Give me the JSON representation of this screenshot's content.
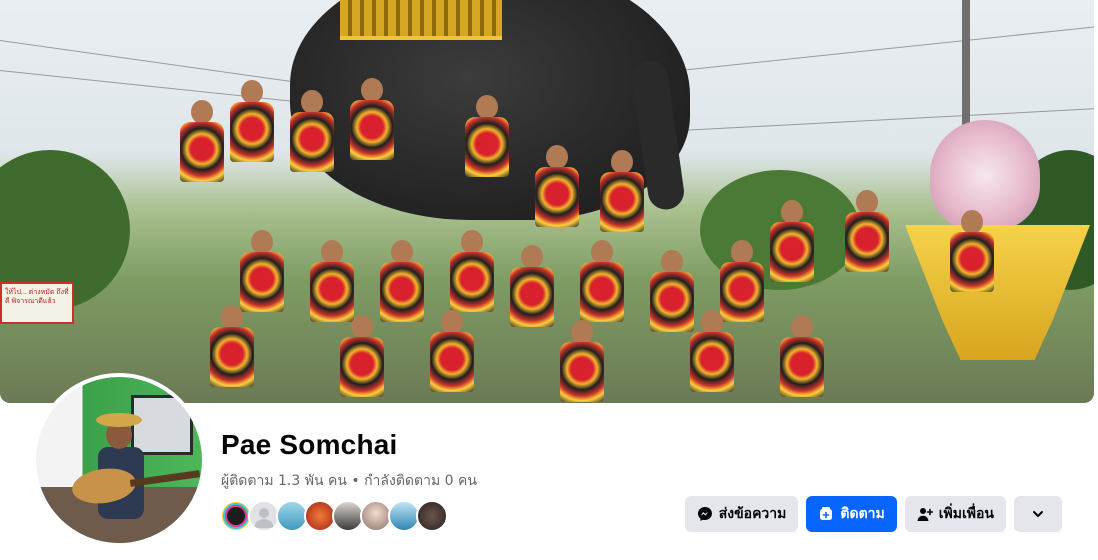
{
  "colors": {
    "primary_button": "#0866ff",
    "secondary_button": "#e4e6eb",
    "name_text": "#050505",
    "meta_text": "#65676b"
  },
  "cover": {
    "sign_text": "ให้ไป... ต่างหมัด ถึงที่ดี พิจารณาดีแล้ว"
  },
  "profile": {
    "name": "Pae Somchai",
    "follow_stats": "ผู้ติดตาม 1.3 พัน คน • กำลังติดตาม 0 คน"
  },
  "mutual_friends": [
    {
      "icon": "fun-music-avatar",
      "color": "#1d1d1d"
    },
    {
      "icon": "default-avatar",
      "color": "#dfe1e5"
    },
    {
      "icon": "photo-avatar",
      "color": "#68b6c9"
    },
    {
      "icon": "photo-avatar",
      "color": "#d84a2a"
    },
    {
      "icon": "photo-avatar",
      "color": "#3b3b3b"
    },
    {
      "icon": "photo-avatar",
      "color": "#c9b2a8"
    },
    {
      "icon": "photo-avatar",
      "color": "#4a9fc9"
    },
    {
      "icon": "photo-avatar",
      "color": "#4b3a36"
    }
  ],
  "actions": {
    "message_label": "ส่งข้อความ",
    "message_icon": "messenger-icon",
    "follow_label": "ติดตาม",
    "follow_icon": "follow-icon",
    "add_friend_label": "เพิ่มเพื่อน",
    "add_friend_icon": "add-friend-icon",
    "more_icon": "chevron-down-icon"
  }
}
